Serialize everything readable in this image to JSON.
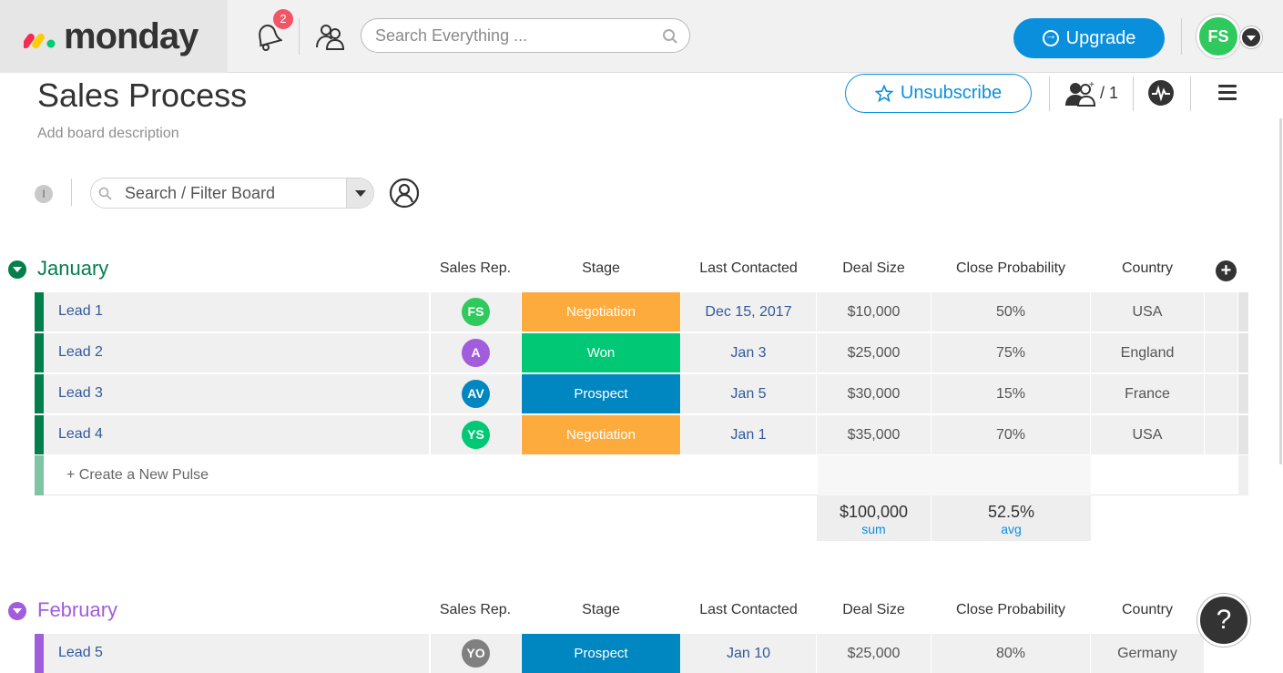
{
  "app": {
    "brand": "monday",
    "notification_count": "2",
    "search_placeholder": "Search Everything ...",
    "upgrade_label": "Upgrade",
    "user_initials": "FS"
  },
  "board": {
    "title": "Sales Process",
    "description_placeholder": "Add board description",
    "unsubscribe_label": "Unsubscribe",
    "members_count": "/ 1",
    "filter_placeholder": "Search / Filter Board",
    "info_label": "I"
  },
  "columns": [
    "Sales Rep.",
    "Stage",
    "Last Contacted",
    "Deal Size",
    "Close Probability",
    "Country"
  ],
  "colors": {
    "january": "#037f4c",
    "february": "#a25ddc",
    "negotiation": "#fdab3d",
    "won": "#00c875",
    "prospect": "#0086c0",
    "accent": "#0a8fdc"
  },
  "groups": [
    {
      "title": "January",
      "rows": [
        {
          "name": "Lead 1",
          "rep": "FS",
          "rep_color": "#30c95e",
          "stage": "Negotiation",
          "stage_color": "#fdab3d",
          "date": "Dec 15, 2017",
          "deal": "$10,000",
          "prob": "50%",
          "country": "USA"
        },
        {
          "name": "Lead 2",
          "rep": "A",
          "rep_color": "#a25ddc",
          "stage": "Won",
          "stage_color": "#00c875",
          "date": "Jan 3",
          "deal": "$25,000",
          "prob": "75%",
          "country": "England"
        },
        {
          "name": "Lead 3",
          "rep": "AV",
          "rep_color": "#0086c0",
          "stage": "Prospect",
          "stage_color": "#0086c0",
          "date": "Jan 5",
          "deal": "$30,000",
          "prob": "15%",
          "country": "France"
        },
        {
          "name": "Lead 4",
          "rep": "YS",
          "rep_color": "#00c875",
          "stage": "Negotiation",
          "stage_color": "#fdab3d",
          "date": "Jan 1",
          "deal": "$35,000",
          "prob": "70%",
          "country": "USA"
        }
      ],
      "create_label": "+ Create a New Pulse",
      "summary": {
        "deal_value": "$100,000",
        "deal_label": "sum",
        "prob_value": "52.5%",
        "prob_label": "avg"
      }
    },
    {
      "title": "February",
      "rows": [
        {
          "name": "Lead 5",
          "rep": "YO",
          "rep_color": "#808080",
          "stage": "Prospect",
          "stage_color": "#0086c0",
          "date": "Jan 10",
          "deal": "$25,000",
          "prob": "80%",
          "country": "Germany"
        }
      ]
    }
  ],
  "help_label": "?"
}
